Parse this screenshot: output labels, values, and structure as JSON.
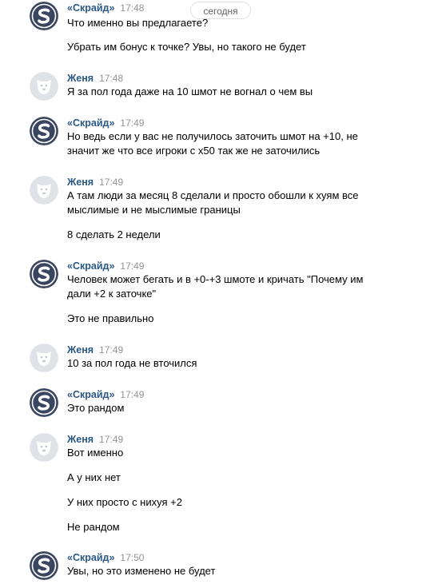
{
  "day_separator": "сегодня",
  "authors": {
    "skraid": {
      "name": "«Скрайд»",
      "color": "#2a5885",
      "avatar_icon": "skraid-s-logo-icon"
    },
    "zhenya": {
      "name": "Женя",
      "color": "#2a5885",
      "avatar_icon": "default-dog-avatar-icon"
    }
  },
  "messages": [
    {
      "author": "«Скрайд»",
      "time": "17:48",
      "lines": [
        "Что именно вы предлагаете?",
        "Убрать им бонус к точке? Увы, но такого не будет"
      ]
    },
    {
      "author": "Женя",
      "time": "17:48",
      "lines": [
        "Я за пол года даже на 10 шмот не вогнал о чем вы"
      ]
    },
    {
      "author": "«Скрайд»",
      "time": "17:49",
      "lines": [
        "Но ведь если у вас не получилось заточить шмот на +10, не",
        "значит же что все игроки с х50 так же не заточились"
      ]
    },
    {
      "author": "Женя",
      "time": "17:49",
      "lines": [
        "А там люди за месяц 8 сделали и просто обошли к хуям все",
        "мыслимые и не мыслимые границы",
        "8 сделать 2 недели"
      ]
    },
    {
      "author": "«Скрайд»",
      "time": "17:49",
      "lines": [
        "Человек может бегать и в +0-+3 шмоте и кричать \"Почему им",
        "дали +2 к заточке\"",
        "Это не правильно"
      ]
    },
    {
      "author": "Женя",
      "time": "17:49",
      "lines": [
        "10 за пол года не вточился"
      ]
    },
    {
      "author": "«Скрайд»",
      "time": "17:49",
      "lines": [
        "Это рандом"
      ]
    },
    {
      "author": "Женя",
      "time": "17:49",
      "lines": [
        "Вот именно",
        "А у них нет",
        "У них просто с нихуя +2",
        "Не рандом"
      ]
    },
    {
      "author": "«Скрайд»",
      "time": "17:50",
      "lines": [
        "Увы, но это изменено не будет"
      ]
    }
  ]
}
